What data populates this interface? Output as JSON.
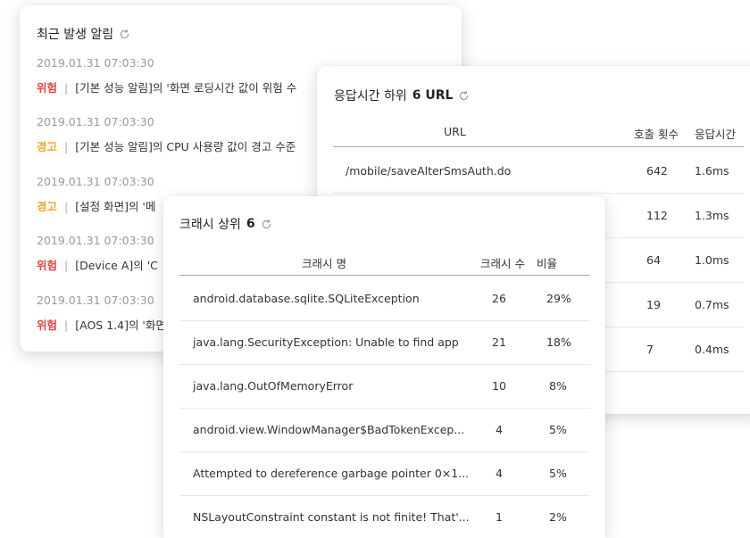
{
  "alerts_card": {
    "title": "최근 발생 알림",
    "items": [
      {
        "time": "2019.01.31 07:03:30",
        "level": "위험",
        "text": "[기본 성능 알림]의 '화면 로딩시간 값이 위험 수"
      },
      {
        "time": "2019.01.31 07:03:30",
        "level": "경고",
        "text": "[기본 성능 알림]의 CPU 사용량 값이 경고 수준"
      },
      {
        "time": "2019.01.31 07:03:30",
        "level": "경고",
        "text": "[설정 화면]의 '메"
      },
      {
        "time": "2019.01.31 07:03:30",
        "level": "위험",
        "text": "[Device A]의 'C"
      },
      {
        "time": "2019.01.31 07:03:30",
        "level": "위험",
        "text": "[AOS 1.4]의 '화면"
      }
    ],
    "separator": "|"
  },
  "url_card": {
    "title_prefix": "응답시간 하위",
    "title_bold": "6 URL",
    "columns": {
      "url": "URL",
      "calls": "호출 횟수",
      "time": "응답시간"
    },
    "rows": [
      {
        "url": "/mobile/saveAlterSmsAuth.do",
        "calls": "642",
        "time": "1.6ms"
      },
      {
        "url": "",
        "calls": "112",
        "time": "1.3ms"
      },
      {
        "url": "",
        "calls": "64",
        "time": "1.0ms"
      },
      {
        "url": "",
        "calls": "19",
        "time": "0.7ms"
      },
      {
        "url": "",
        "calls": "7",
        "time": "0.4ms"
      }
    ]
  },
  "crash_card": {
    "title_prefix": "크래시 상위",
    "title_bold": "6",
    "columns": {
      "name": "크래시 명",
      "count": "크래시 수",
      "ratio": "비율"
    },
    "rows": [
      {
        "name": "android.database.sqlite.SQLiteException",
        "count": "26",
        "ratio": "29%"
      },
      {
        "name": "java.lang.SecurityException: Unable to find app",
        "count": "21",
        "ratio": "18%"
      },
      {
        "name": "java.lang.OutOfMemoryError",
        "count": "10",
        "ratio": "8%"
      },
      {
        "name": "android.view.WindowManager$BadTokenExcep...",
        "count": "4",
        "ratio": "5%"
      },
      {
        "name": "Attempted to dereference garbage pointer 0×1...",
        "count": "4",
        "ratio": "5%"
      },
      {
        "name": "NSLayoutConstraint constant is not finite! That'...",
        "count": "1",
        "ratio": "2%"
      }
    ]
  },
  "colors": {
    "danger": "#e8413f",
    "warning": "#f5a623",
    "header_rule": "#9aa9bd"
  },
  "icons": {
    "refresh": "refresh-icon"
  }
}
